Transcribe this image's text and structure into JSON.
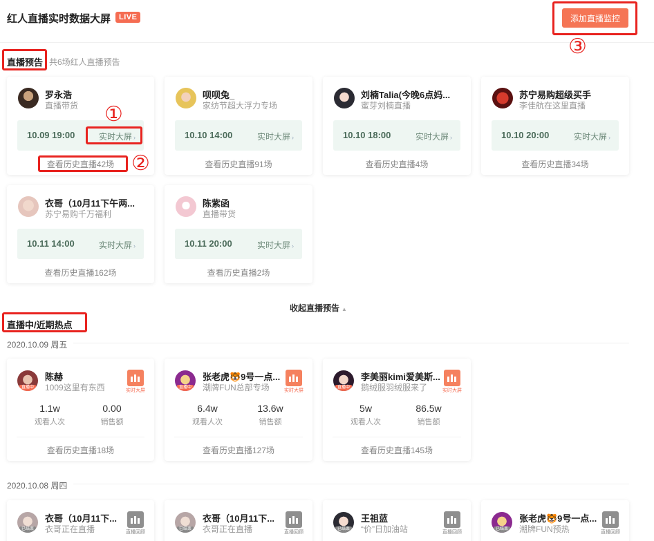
{
  "header": {
    "title": "红人直播实时数据大屏",
    "live_badge": "LIVE",
    "add_button": "添加直播监控"
  },
  "annotations": {
    "n1": "①",
    "n2": "②",
    "n3": "③"
  },
  "preview": {
    "title": "直播预告",
    "subtitle": "共6场红人直播预告",
    "collapse_label": "收起直播预告",
    "cards": [
      {
        "name": "罗永浩",
        "desc": "直播带货",
        "time": "10.09 19:00",
        "screen": "实时大屏",
        "history": "查看历史直播42场"
      },
      {
        "name": "呗呗兔_",
        "desc": "家纺节超大浮力专场",
        "time": "10.10 14:00",
        "screen": "实时大屏",
        "history": "查看历史直播91场"
      },
      {
        "name": "刘楠Talia(今晚6点妈...",
        "desc": "蜜芽刘楠直播",
        "time": "10.10 18:00",
        "screen": "实时大屏",
        "history": "查看历史直播4场"
      },
      {
        "name": "苏宁易购超级买手",
        "desc": "李佳航在这里直播",
        "time": "10.10 20:00",
        "screen": "实时大屏",
        "history": "查看历史直播34场"
      },
      {
        "name": "衣哥（10月11下午两...",
        "desc": "苏宁易购千万福利",
        "time": "10.11 14:00",
        "screen": "实时大屏",
        "history": "查看历史直播162场"
      },
      {
        "name": "陈紫函",
        "desc": "直播带货",
        "time": "10.11 20:00",
        "screen": "实时大屏",
        "history": "查看历史直播2场"
      }
    ]
  },
  "hot": {
    "title": "直播中/近期热点",
    "days": [
      {
        "date": "2020.10.09  周五",
        "cards": [
          {
            "name": "陈赫",
            "desc": "1009这里有东西",
            "tag": "直播中",
            "btn": "实时大屏",
            "views": "1.1w",
            "views_label": "观看人次",
            "sales": "0.00",
            "sales_label": "销售额",
            "history": "查看历史直播18场"
          },
          {
            "name": "张老虎🐯9号一点...",
            "desc": "潮牌FUN总部专场",
            "tag": "直播中",
            "btn": "实时大屏",
            "views": "6.4w",
            "views_label": "观看人次",
            "sales": "13.6w",
            "sales_label": "销售额",
            "history": "查看历史直播127场"
          },
          {
            "name": "李美丽kimi爱美斯...",
            "desc": "鹅绒服羽绒服来了",
            "tag": "直播中",
            "btn": "实时大屏",
            "views": "5w",
            "views_label": "观看人次",
            "sales": "86.5w",
            "sales_label": "销售额",
            "history": "查看历史直播145场"
          }
        ]
      },
      {
        "date": "2020.10.08  周四",
        "cards": [
          {
            "name": "衣哥（10月11下...",
            "desc": "衣哥正在直播",
            "tag": "已结束",
            "btn": "直播回顾"
          },
          {
            "name": "衣哥（10月11下...",
            "desc": "衣哥正在直播",
            "tag": "已结束",
            "btn": "直播回顾"
          },
          {
            "name": "王祖蓝",
            "desc": "“价”日加油站",
            "tag": "已结束",
            "btn": "直播回顾"
          },
          {
            "name": "张老虎🐯9号一点...",
            "desc": "潮牌FUN预热",
            "tag": "已结束",
            "btn": "直播回顾"
          }
        ]
      }
    ]
  },
  "colors": {
    "accent": "#f56c52",
    "highlight_box": "#e8231f",
    "time_box_bg": "#eef6f2"
  }
}
